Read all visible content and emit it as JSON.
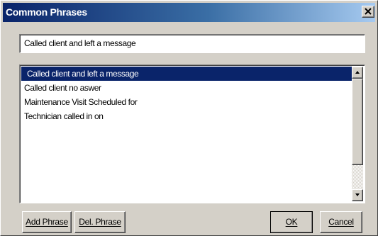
{
  "window": {
    "title": "Common Phrases"
  },
  "titlebar": {
    "close_icon": "close-icon"
  },
  "phrase_input": {
    "value": "Called client and left a message"
  },
  "phrase_list": {
    "items": [
      {
        "label": "Called client and left a message",
        "selected": true
      },
      {
        "label": "Called client no aswer",
        "selected": false
      },
      {
        "label": "Maintenance Visit Scheduled for",
        "selected": false
      },
      {
        "label": "Technician called in on",
        "selected": false
      }
    ]
  },
  "buttons": {
    "add_phrase": "Add Phrase",
    "del_phrase": "Del. Phrase",
    "ok": "OK",
    "cancel": "Cancel"
  },
  "colors": {
    "face": "#d4d0c8",
    "title_start": "#0a246a",
    "title_end": "#a6caf0",
    "selection": "#0a246a"
  }
}
